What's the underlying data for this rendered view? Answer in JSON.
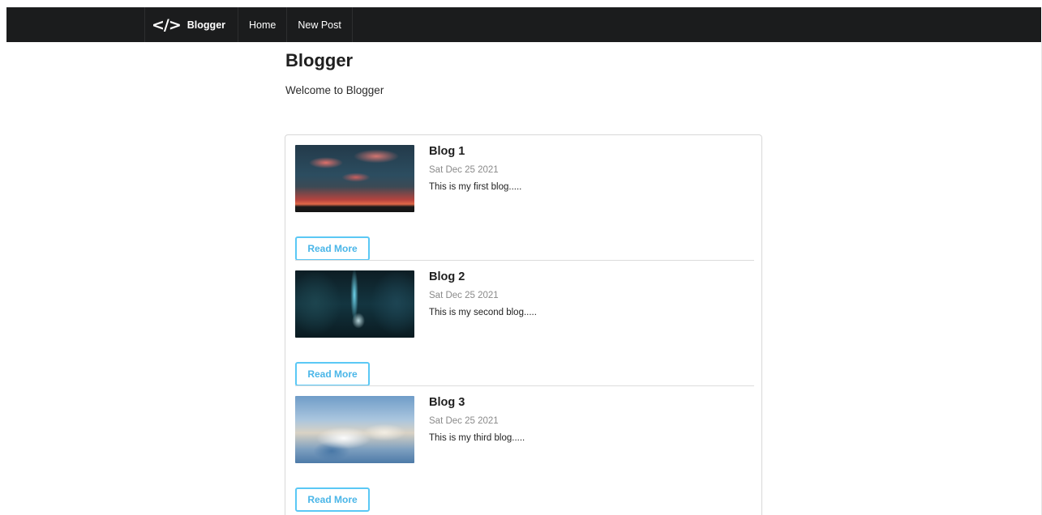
{
  "navbar": {
    "brand_icon": "</>",
    "brand_label": "Blogger",
    "items": [
      {
        "label": "Home"
      },
      {
        "label": "New Post"
      }
    ]
  },
  "header": {
    "title": "Blogger",
    "subtitle": "Welcome to Blogger"
  },
  "posts": [
    {
      "title": "Blog 1",
      "date": "Sat Dec 25 2021",
      "description": "This is my first blog.....",
      "read_more_label": "Read More",
      "image": "sunset-clouds-image"
    },
    {
      "title": "Blog 2",
      "date": "Sat Dec 25 2021",
      "description": "This is my second blog.....",
      "read_more_label": "Read More",
      "image": "ice-cave-light-image"
    },
    {
      "title": "Blog 3",
      "date": "Sat Dec 25 2021",
      "description": "This is my third blog.....",
      "read_more_label": "Read More",
      "image": "sky-clouds-image"
    }
  ],
  "colors": {
    "navbar_bg": "#1b1c1d",
    "button_accent": "#5bc8f5"
  }
}
